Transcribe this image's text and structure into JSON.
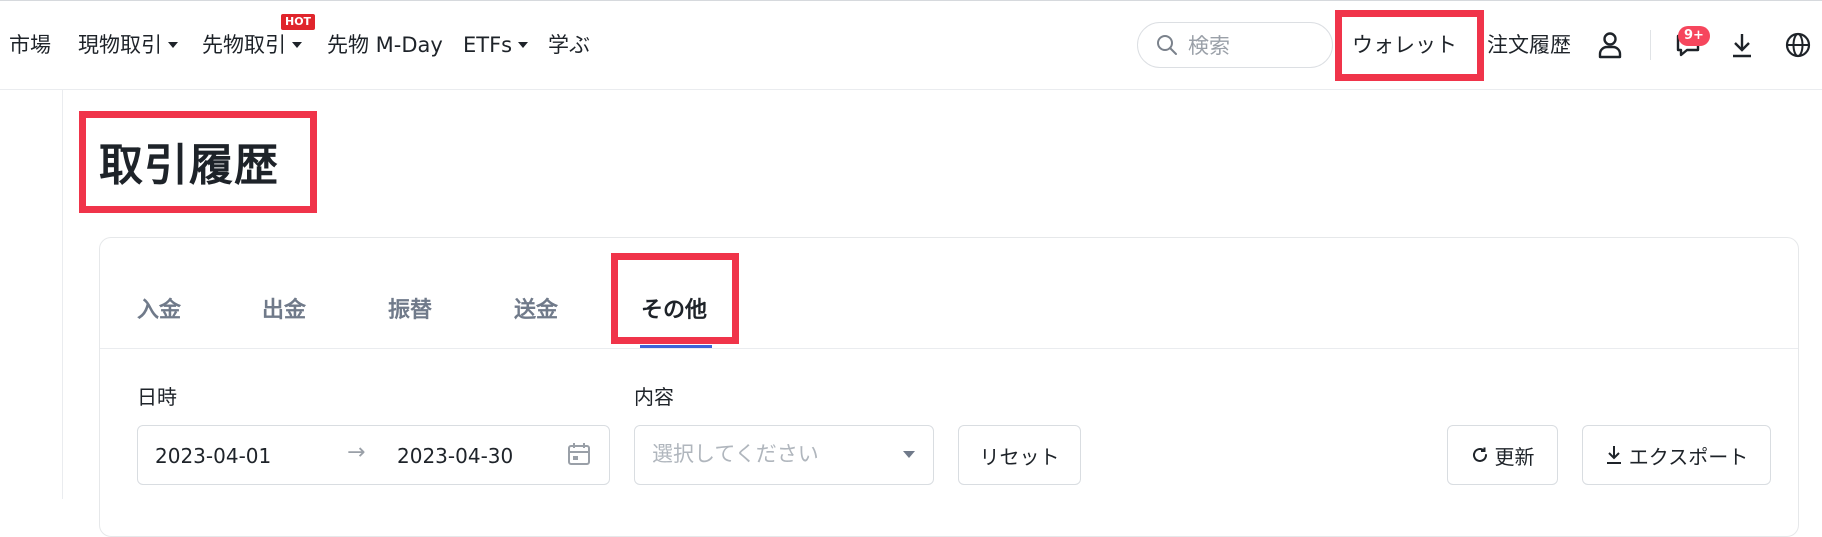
{
  "nav": {
    "items": [
      {
        "label": "市場"
      },
      {
        "label": "現物取引"
      },
      {
        "label": "先物取引"
      },
      {
        "label": "先物 M-Day"
      },
      {
        "label": "ETFs"
      },
      {
        "label": "学ぶ"
      }
    ],
    "hot_badge": "HOT",
    "search_placeholder": "検索",
    "wallet": "ウォレット",
    "order_history": "注文履歴",
    "notification_count": "9+",
    "icons": [
      "search-icon",
      "user-icon",
      "message-icon",
      "download-icon",
      "globe-icon"
    ]
  },
  "page": {
    "title": "取引履歴"
  },
  "tabs": [
    {
      "label": "入金",
      "active": false
    },
    {
      "label": "出金",
      "active": false
    },
    {
      "label": "振替",
      "active": false
    },
    {
      "label": "送金",
      "active": false
    },
    {
      "label": "その他",
      "active": true
    }
  ],
  "filters": {
    "date_label": "日時",
    "start_date": "2023-04-01",
    "end_date": "2023-04-30",
    "date_separator": "→",
    "content_label": "内容",
    "content_placeholder": "選択してください",
    "reset": "リセット",
    "refresh": "更新",
    "export": "エクスポート"
  },
  "colors": {
    "highlight": "#f0344a",
    "active_tab_underline": "#3d63d8",
    "hot_badge": "#e0252c",
    "notification_badge": "#f6465d"
  }
}
